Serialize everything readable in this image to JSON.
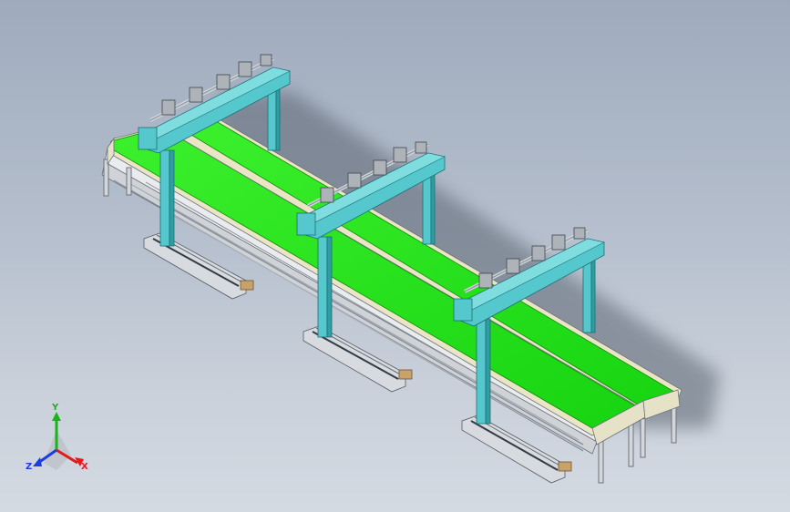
{
  "colors": {
    "background_top": "#9fabbd",
    "background_bottom": "#d4dae2",
    "belt": "#22e01a",
    "belt_edge": "#12a00c",
    "bed": "#ece8cc",
    "frame": "#b9bec6",
    "gantry": "#54c8cc",
    "gantry_dark": "#2f9ea4",
    "rail_base": "#d6d9dd",
    "motor": "#c9a26a",
    "gripper": "#a8adb4",
    "axis_x": "#e21b1b",
    "axis_y": "#19b41a",
    "axis_z": "#1c3de0"
  },
  "axis_triad": {
    "x_label": "X",
    "y_label": "Y",
    "z_label": "Z"
  },
  "model": {
    "conveyor_lanes": 2,
    "gantry_units": 3
  }
}
